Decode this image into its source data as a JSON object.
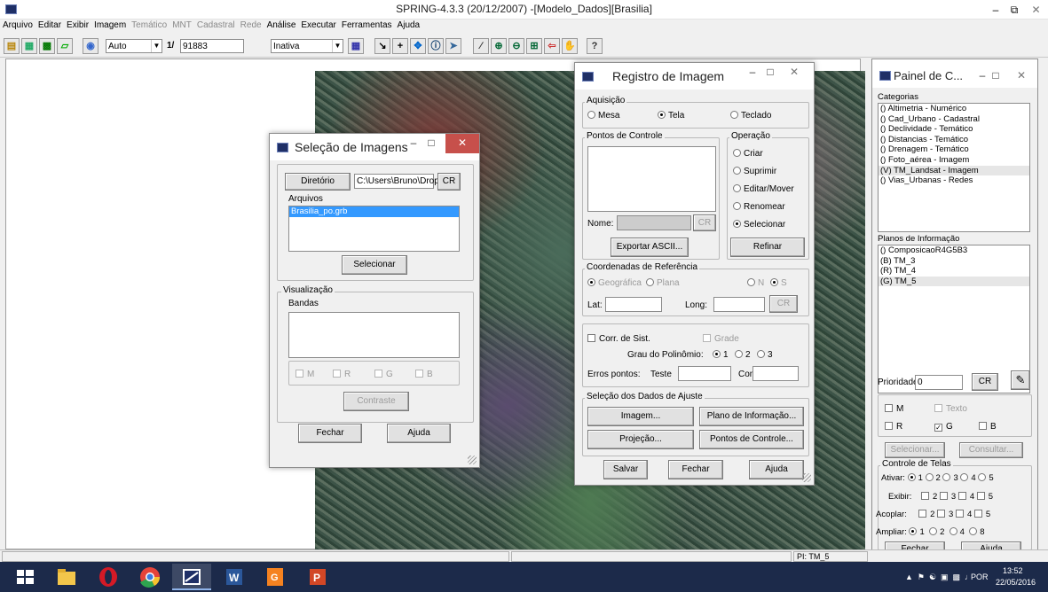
{
  "app": {
    "title": "SPRING-4.3.3 (20/12/2007) -[Modelo_Dados][Brasilia]"
  },
  "menu": [
    "Arquivo",
    "Editar",
    "Exibir",
    "Imagem",
    "Temático",
    "MNT",
    "Cadastral",
    "Rede",
    "Análise",
    "Executar",
    "Ferramentas",
    "Ajuda"
  ],
  "toolbar": {
    "zoom_mode": "Auto",
    "scale_prefix": "1/",
    "scale_value": "91883",
    "plane_mode": "Inativa"
  },
  "selecao": {
    "title": "Seleção de Imagens",
    "diretorio_btn": "Diretório",
    "diretorio_value": "C:\\Users\\Bruno\\Drop",
    "cr": "CR",
    "arquivos_label": "Arquivos",
    "files": [
      "Brasilia_po.grb"
    ],
    "selecionar": "Selecionar",
    "visualizacao": "Visualização",
    "bandas": "Bandas",
    "band_checks": [
      "M",
      "R",
      "G",
      "B"
    ],
    "contraste": "Contraste",
    "fechar": "Fechar",
    "ajuda": "Ajuda"
  },
  "registro": {
    "title": "Registro de Imagem",
    "aquisicao": "Aquisição",
    "acq": [
      "Mesa",
      "Tela",
      "Teclado"
    ],
    "pontos": "Pontos de Controle",
    "operacao": "Operação",
    "ops": [
      "Criar",
      "Suprimir",
      "Editar/Mover",
      "Renomear",
      "Selecionar"
    ],
    "nome": "Nome:",
    "cr": "CR",
    "exportar": "Exportar ASCII...",
    "refinar": "Refinar",
    "coord": "Coordenadas de Referência",
    "geografica": "Geográfica",
    "plana": "Plana",
    "n": "N",
    "s": "S",
    "lat": "Lat:",
    "long": "Long:",
    "corr": "Corr. de Sist.",
    "grade": "Grade",
    "grau": "Grau do Polinômio:",
    "grau_opts": [
      "1",
      "2",
      "3"
    ],
    "erros": "Erros pontos:",
    "teste": "Teste",
    "controle": "Controle",
    "selecao_dados": "Seleção dos Dados de Ajuste",
    "imagem": "Imagem...",
    "plano": "Plano de Informação...",
    "projecao": "Projeção...",
    "pontos_btn": "Pontos de Controle...",
    "salvar": "Salvar",
    "fechar": "Fechar",
    "ajuda": "Ajuda"
  },
  "painel": {
    "title": "Painel de C...",
    "categorias": "Categorias",
    "cat_items": [
      "() Altimetria - Numérico",
      "() Cad_Urbano - Cadastral",
      "() Declividade - Temático",
      "() Distancias - Temático",
      "() Drenagem - Temático",
      "() Foto_aérea - Imagem",
      "(V) TM_Landsat - Imagem",
      "() Vias_Urbanas - Redes"
    ],
    "planos": "Planos de Informação",
    "plano_items": [
      "() ComposicaoR4G5B3",
      "(B) TM_3",
      "(R) TM_4",
      "(G) TM_5"
    ],
    "prioridade": "Prioridade:",
    "prioridade_value": "0",
    "cr": "CR",
    "m": "M",
    "texto": "Texto",
    "r": "R",
    "g": "G",
    "b": "B",
    "selecionar": "Selecionar...",
    "consultar": "Consultar...",
    "controle_telas": "Controle de Telas",
    "ativar": "Ativar:",
    "exibir": "Exibir:",
    "acoplar": "Acoplar:",
    "ampliar": "Ampliar:",
    "nums5": [
      "1",
      "2",
      "3",
      "4",
      "5"
    ],
    "nums4": [
      "2",
      "3",
      "4",
      "5"
    ],
    "ampliar_opts": [
      "1",
      "2",
      "4",
      "8"
    ],
    "fechar": "Fechar",
    "ajuda": "Ajuda"
  },
  "status": {
    "pi": "PI: TM_5"
  },
  "tray": {
    "lang": "POR",
    "time": "13:52",
    "date": "22/05/2016"
  }
}
